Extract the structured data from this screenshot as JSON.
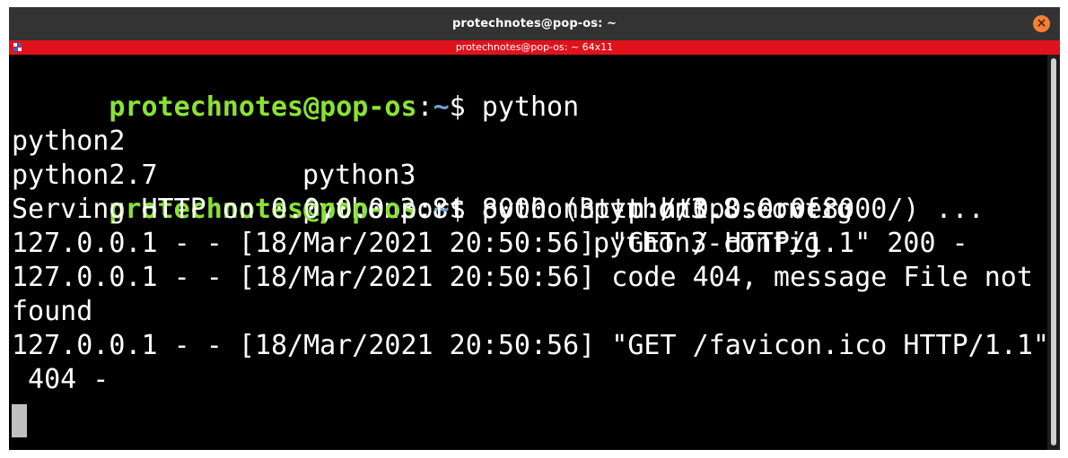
{
  "window": {
    "title": "protechnotes@pop-os: ~",
    "close_glyph": "×"
  },
  "tmux": {
    "title": "protechnotes@pop-os: ~ 64x11"
  },
  "prompt": {
    "user_host": "protechnotes@pop-os",
    "sep": ":",
    "path": "~",
    "symbol": "$"
  },
  "terminal": {
    "cmd1": " python",
    "completions": {
      "row1": [
        "python2",
        "python3",
        "python3.8-config"
      ],
      "row2": [
        "python2.7",
        "python3.8",
        "python3-config"
      ]
    },
    "cmd2": " python3 -m http.server",
    "output": [
      "Serving HTTP on 0.0.0.0 port 8000 (http://0.0.0.0:8000/) ...",
      "127.0.0.1 - - [18/Mar/2021 20:50:56] \"GET / HTTP/1.1\" 200 -",
      "127.0.0.1 - - [18/Mar/2021 20:50:56] code 404, message File not",
      "found",
      "127.0.0.1 - - [18/Mar/2021 20:50:56] \"GET /favicon.ico HTTP/1.1\"",
      " 404 -"
    ]
  },
  "colors": {
    "titlebar": "#333333",
    "tmux_bar": "#e0121b",
    "prompt_user": "#8ae234",
    "prompt_path": "#729fcf",
    "close_button": "#fb7f33"
  }
}
